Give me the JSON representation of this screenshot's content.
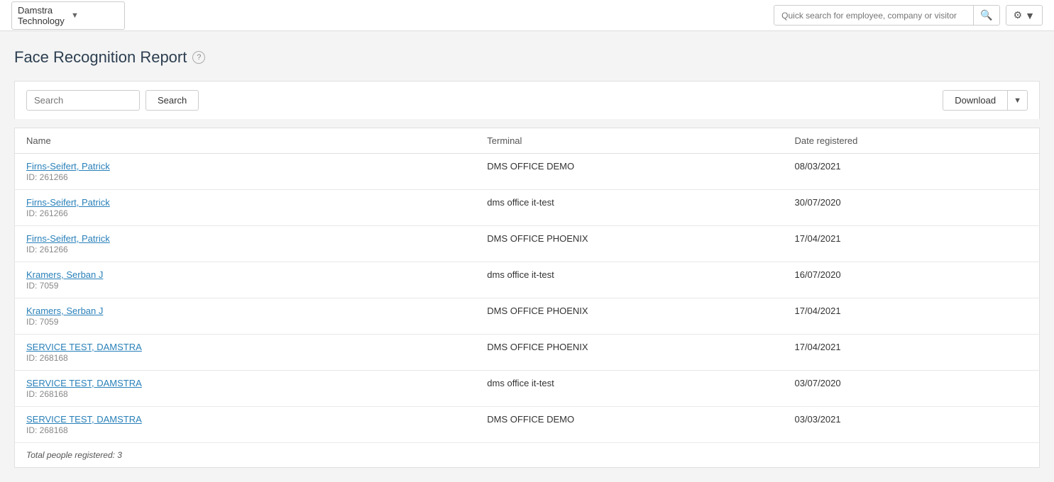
{
  "nav": {
    "company": "Damstra Technology",
    "search_placeholder": "Quick search for employee, company or visitor"
  },
  "page": {
    "title": "Face Recognition Report",
    "help_icon": "?"
  },
  "filters": {
    "search_placeholder": "Search",
    "search_btn_label": "Search",
    "download_btn_label": "Download"
  },
  "table": {
    "columns": [
      "Name",
      "Terminal",
      "Date registered"
    ],
    "rows": [
      {
        "name": "Firns-Seifert, Patrick",
        "id": "ID: 261266",
        "terminal": "DMS OFFICE DEMO",
        "date": "08/03/2021"
      },
      {
        "name": "Firns-Seifert, Patrick",
        "id": "ID: 261266",
        "terminal": "dms office it-test",
        "date": "30/07/2020"
      },
      {
        "name": "Firns-Seifert, Patrick",
        "id": "ID: 261266",
        "terminal": "DMS OFFICE PHOENIX",
        "date": "17/04/2021"
      },
      {
        "name": "Kramers, Serban J",
        "id": "ID: 7059",
        "terminal": "dms office it-test",
        "date": "16/07/2020"
      },
      {
        "name": "Kramers, Serban J",
        "id": "ID: 7059",
        "terminal": "DMS OFFICE PHOENIX",
        "date": "17/04/2021"
      },
      {
        "name": "SERVICE TEST, DAMSTRA",
        "id": "ID: 268168",
        "terminal": "DMS OFFICE PHOENIX",
        "date": "17/04/2021"
      },
      {
        "name": "SERVICE TEST, DAMSTRA",
        "id": "ID: 268168",
        "terminal": "dms office it-test",
        "date": "03/07/2020"
      },
      {
        "name": "SERVICE TEST, DAMSTRA",
        "id": "ID: 268168",
        "terminal": "DMS OFFICE DEMO",
        "date": "03/03/2021"
      }
    ],
    "footer": "Total people registered: 3"
  }
}
